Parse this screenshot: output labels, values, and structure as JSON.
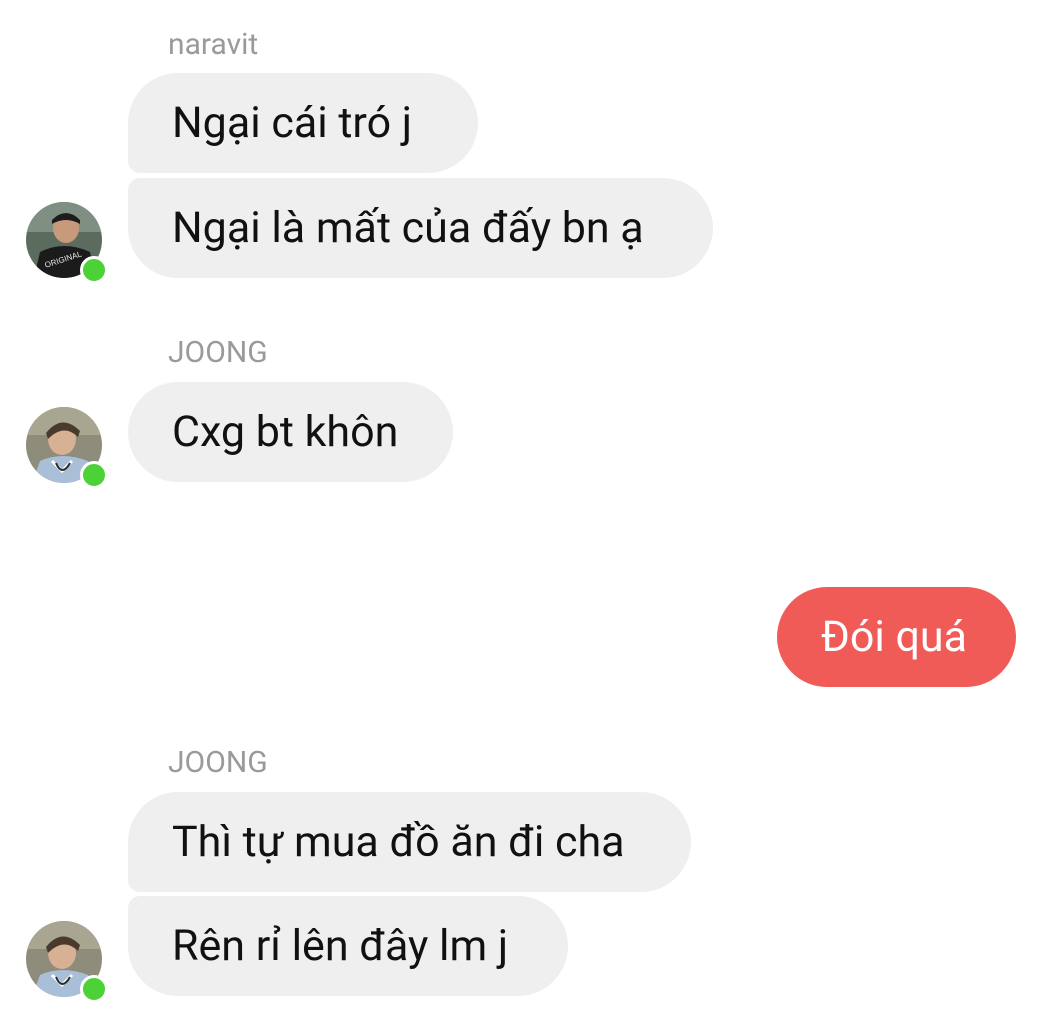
{
  "messages": [
    {
      "sender": "naravit",
      "bubbles": [
        "Ngại cái tró j",
        "Ngại là mất của đấy bn ạ"
      ]
    },
    {
      "sender": "JOONG",
      "bubbles": [
        "Cxg bt khôn"
      ]
    },
    {
      "outgoing": "Đói quá"
    },
    {
      "sender": "JOONG",
      "bubbles": [
        "Thì tự mua đồ ăn đi cha",
        "Rên rỉ lên đây lm j"
      ]
    }
  ],
  "avatar_shirt_text": "ORIGINAL",
  "colors": {
    "incoming_bubble": "#efefef",
    "outgoing_bubble": "#f05b57",
    "online_dot": "#4cd137",
    "sender_name": "#9a9a9a"
  }
}
